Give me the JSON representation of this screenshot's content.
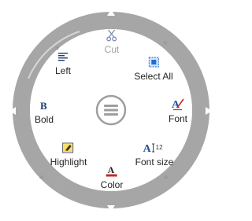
{
  "menu": {
    "items": [
      {
        "key": "cut",
        "label": "Cut",
        "icon": "scissors-icon",
        "enabled": false
      },
      {
        "key": "select_all",
        "label": "Select All",
        "icon": "select-all-icon",
        "enabled": true
      },
      {
        "key": "font",
        "label": "Font",
        "icon": "font-icon",
        "enabled": true
      },
      {
        "key": "font_size",
        "label": "Font size",
        "icon": "font-size-icon",
        "enabled": true
      },
      {
        "key": "color",
        "label": "Color",
        "icon": "font-color-icon",
        "enabled": true
      },
      {
        "key": "highlight",
        "label": "Highlight",
        "icon": "highlight-icon",
        "enabled": true
      },
      {
        "key": "bold",
        "label": "Bold",
        "icon": "bold-icon",
        "enabled": true
      },
      {
        "key": "left",
        "label": "Left",
        "icon": "align-left-icon",
        "enabled": true
      }
    ],
    "font_size_badge": "12",
    "center_icon": "hamburger-menu-icon",
    "colors": {
      "ring": "#a6a6a6",
      "arrow": "#ffffff",
      "accent_blue": "#1e6fd1",
      "accent_red": "#c62828"
    }
  }
}
